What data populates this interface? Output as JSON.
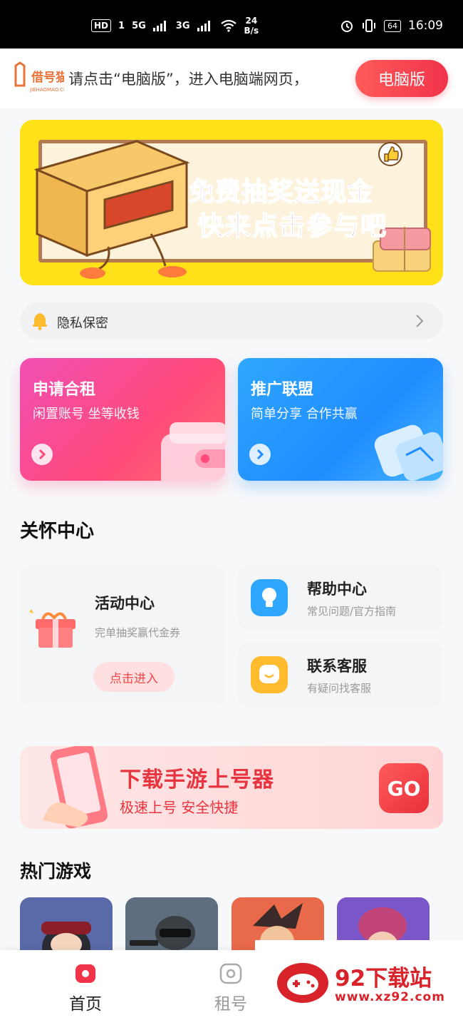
{
  "status_bar": {
    "hd": "HD",
    "sim": "1",
    "net1": "5G",
    "net2": "3G",
    "speed_value": "24",
    "speed_unit": "B/s",
    "battery": "64",
    "time": "16:09"
  },
  "top_banner": {
    "logo_text": "借号猫",
    "logo_url": "JIEHAOMAO.COM",
    "message": "请点击“电脑版”，进入电脑端网页，",
    "pc_button": "电脑版"
  },
  "lottery_banner": {
    "line1": "免费抽奖送现金",
    "line2": "快来点击参与吧"
  },
  "privacy_notice": {
    "text": "隐私保密"
  },
  "feature_cards": [
    {
      "title": "申请合租",
      "subtitle": "闲置账号 坐等收钱"
    },
    {
      "title": "推广联盟",
      "subtitle": "简单分享 合作共赢"
    }
  ],
  "care_center": {
    "title": "关怀中心",
    "activity": {
      "title": "活动中心",
      "subtitle": "完单抽奖赢代金券",
      "button": "点击进入"
    },
    "help": {
      "title": "帮助中心",
      "subtitle": "常见问题/官方指南"
    },
    "service": {
      "title": "联系客服",
      "subtitle": "有疑问找客服"
    }
  },
  "download_banner": {
    "title": "下载手游上号器",
    "subtitle": "极速上号 安全快捷",
    "go": "GO"
  },
  "hot_games": {
    "title": "热门游戏"
  },
  "bottom_nav": {
    "items": [
      {
        "label": "首页",
        "active": true
      },
      {
        "label": "租号",
        "active": false
      }
    ]
  },
  "watermark": {
    "brand": "92下载站",
    "url": "www.xz92.com"
  },
  "colors": {
    "accent": "#f0344a",
    "rent_card": "#ff4a7a",
    "promo_card": "#1f8cff",
    "lottery_yellow": "#ffe11a"
  }
}
